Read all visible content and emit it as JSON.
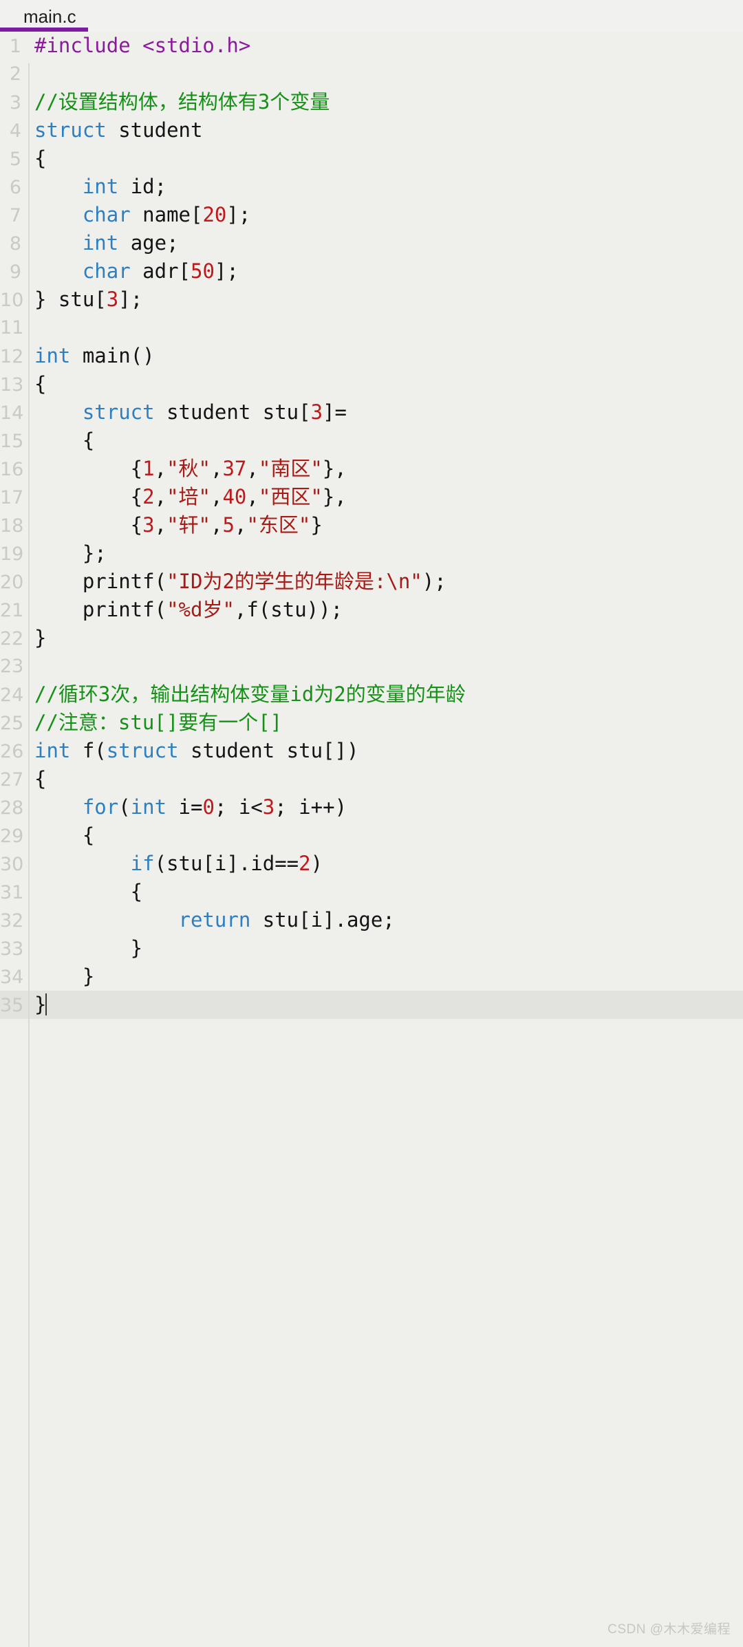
{
  "tab": {
    "filename": "main.c",
    "active_underline_color": "#7b1fa2"
  },
  "watermark": "CSDN @木木爱编程",
  "editor": {
    "active_line": 35,
    "cursor_line": 35,
    "colors": {
      "background": "#eff0ec",
      "preprocessor": "#8b1a9c",
      "keyword": "#2d7fc1",
      "number": "#c0191c",
      "string": "#a81a16",
      "comment": "#169117",
      "plain": "#141414",
      "line_number": "#c9cac5",
      "active_line_bg": "#e2e3df"
    },
    "lines": [
      {
        "n": "1",
        "tokens": [
          {
            "t": "pre",
            "s": "#include <stdio.h>"
          }
        ]
      },
      {
        "n": "2",
        "tokens": []
      },
      {
        "n": "3",
        "tokens": [
          {
            "t": "com",
            "s": "//设置结构体，结构体有3个变量"
          }
        ]
      },
      {
        "n": "4",
        "tokens": [
          {
            "t": "kw",
            "s": "struct"
          },
          {
            "t": "pln",
            "s": " student"
          }
        ]
      },
      {
        "n": "5",
        "tokens": [
          {
            "t": "pln",
            "s": "{"
          }
        ]
      },
      {
        "n": "6",
        "tokens": [
          {
            "t": "pln",
            "s": "    "
          },
          {
            "t": "kw",
            "s": "int"
          },
          {
            "t": "pln",
            "s": " id;"
          }
        ]
      },
      {
        "n": "7",
        "tokens": [
          {
            "t": "pln",
            "s": "    "
          },
          {
            "t": "kw",
            "s": "char"
          },
          {
            "t": "pln",
            "s": " name["
          },
          {
            "t": "num",
            "s": "20"
          },
          {
            "t": "pln",
            "s": "];"
          }
        ]
      },
      {
        "n": "8",
        "tokens": [
          {
            "t": "pln",
            "s": "    "
          },
          {
            "t": "kw",
            "s": "int"
          },
          {
            "t": "pln",
            "s": " age;"
          }
        ]
      },
      {
        "n": "9",
        "tokens": [
          {
            "t": "pln",
            "s": "    "
          },
          {
            "t": "kw",
            "s": "char"
          },
          {
            "t": "pln",
            "s": " adr["
          },
          {
            "t": "num",
            "s": "50"
          },
          {
            "t": "pln",
            "s": "];"
          }
        ]
      },
      {
        "n": "10",
        "tokens": [
          {
            "t": "pln",
            "s": "} stu["
          },
          {
            "t": "num",
            "s": "3"
          },
          {
            "t": "pln",
            "s": "];"
          }
        ]
      },
      {
        "n": "11",
        "tokens": []
      },
      {
        "n": "12",
        "tokens": [
          {
            "t": "kw",
            "s": "int"
          },
          {
            "t": "pln",
            "s": " main()"
          }
        ]
      },
      {
        "n": "13",
        "tokens": [
          {
            "t": "pln",
            "s": "{"
          }
        ]
      },
      {
        "n": "14",
        "tokens": [
          {
            "t": "pln",
            "s": "    "
          },
          {
            "t": "kw",
            "s": "struct"
          },
          {
            "t": "pln",
            "s": " student stu["
          },
          {
            "t": "num",
            "s": "3"
          },
          {
            "t": "pln",
            "s": "]="
          }
        ]
      },
      {
        "n": "15",
        "tokens": [
          {
            "t": "pln",
            "s": "    {"
          }
        ]
      },
      {
        "n": "16",
        "tokens": [
          {
            "t": "pln",
            "s": "        {"
          },
          {
            "t": "num",
            "s": "1"
          },
          {
            "t": "pln",
            "s": ","
          },
          {
            "t": "str",
            "s": "\"秋\""
          },
          {
            "t": "pln",
            "s": ","
          },
          {
            "t": "num",
            "s": "37"
          },
          {
            "t": "pln",
            "s": ","
          },
          {
            "t": "str",
            "s": "\"南区\""
          },
          {
            "t": "pln",
            "s": "},"
          }
        ]
      },
      {
        "n": "17",
        "tokens": [
          {
            "t": "pln",
            "s": "        {"
          },
          {
            "t": "num",
            "s": "2"
          },
          {
            "t": "pln",
            "s": ","
          },
          {
            "t": "str",
            "s": "\"培\""
          },
          {
            "t": "pln",
            "s": ","
          },
          {
            "t": "num",
            "s": "40"
          },
          {
            "t": "pln",
            "s": ","
          },
          {
            "t": "str",
            "s": "\"西区\""
          },
          {
            "t": "pln",
            "s": "},"
          }
        ]
      },
      {
        "n": "18",
        "tokens": [
          {
            "t": "pln",
            "s": "        {"
          },
          {
            "t": "num",
            "s": "3"
          },
          {
            "t": "pln",
            "s": ","
          },
          {
            "t": "str",
            "s": "\"轩\""
          },
          {
            "t": "pln",
            "s": ","
          },
          {
            "t": "num",
            "s": "5"
          },
          {
            "t": "pln",
            "s": ","
          },
          {
            "t": "str",
            "s": "\"东区\""
          },
          {
            "t": "pln",
            "s": "}"
          }
        ]
      },
      {
        "n": "19",
        "tokens": [
          {
            "t": "pln",
            "s": "    };"
          }
        ]
      },
      {
        "n": "20",
        "tokens": [
          {
            "t": "pln",
            "s": "    printf("
          },
          {
            "t": "str",
            "s": "\"ID为2的学生的年龄是:\\n\""
          },
          {
            "t": "pln",
            "s": ");"
          }
        ]
      },
      {
        "n": "21",
        "tokens": [
          {
            "t": "pln",
            "s": "    printf("
          },
          {
            "t": "str",
            "s": "\"%d岁\""
          },
          {
            "t": "pln",
            "s": ",f(stu));"
          }
        ]
      },
      {
        "n": "22",
        "tokens": [
          {
            "t": "pln",
            "s": "}"
          }
        ]
      },
      {
        "n": "23",
        "tokens": []
      },
      {
        "n": "24",
        "tokens": [
          {
            "t": "com",
            "s": "//循环3次，输出结构体变量id为2的变量的年龄"
          }
        ]
      },
      {
        "n": "25",
        "tokens": [
          {
            "t": "com",
            "s": "//注意：stu[]要有一个[]"
          }
        ]
      },
      {
        "n": "26",
        "tokens": [
          {
            "t": "kw",
            "s": "int"
          },
          {
            "t": "pln",
            "s": " f("
          },
          {
            "t": "kw",
            "s": "struct"
          },
          {
            "t": "pln",
            "s": " student stu[])"
          }
        ]
      },
      {
        "n": "27",
        "tokens": [
          {
            "t": "pln",
            "s": "{"
          }
        ]
      },
      {
        "n": "28",
        "tokens": [
          {
            "t": "pln",
            "s": "    "
          },
          {
            "t": "kw",
            "s": "for"
          },
          {
            "t": "pln",
            "s": "("
          },
          {
            "t": "kw",
            "s": "int"
          },
          {
            "t": "pln",
            "s": " i="
          },
          {
            "t": "num",
            "s": "0"
          },
          {
            "t": "pln",
            "s": "; i<"
          },
          {
            "t": "num",
            "s": "3"
          },
          {
            "t": "pln",
            "s": "; i++)"
          }
        ]
      },
      {
        "n": "29",
        "tokens": [
          {
            "t": "pln",
            "s": "    {"
          }
        ]
      },
      {
        "n": "30",
        "tokens": [
          {
            "t": "pln",
            "s": "        "
          },
          {
            "t": "kw",
            "s": "if"
          },
          {
            "t": "pln",
            "s": "(stu[i].id=="
          },
          {
            "t": "num",
            "s": "2"
          },
          {
            "t": "pln",
            "s": ")"
          }
        ]
      },
      {
        "n": "31",
        "tokens": [
          {
            "t": "pln",
            "s": "        {"
          }
        ]
      },
      {
        "n": "32",
        "tokens": [
          {
            "t": "pln",
            "s": "            "
          },
          {
            "t": "kw",
            "s": "return"
          },
          {
            "t": "pln",
            "s": " stu[i].age;"
          }
        ]
      },
      {
        "n": "33",
        "tokens": [
          {
            "t": "pln",
            "s": "        }"
          }
        ]
      },
      {
        "n": "34",
        "tokens": [
          {
            "t": "pln",
            "s": "    }"
          }
        ]
      },
      {
        "n": "35",
        "tokens": [
          {
            "t": "pln",
            "s": "}"
          }
        ],
        "active": true,
        "caret": true
      }
    ]
  }
}
